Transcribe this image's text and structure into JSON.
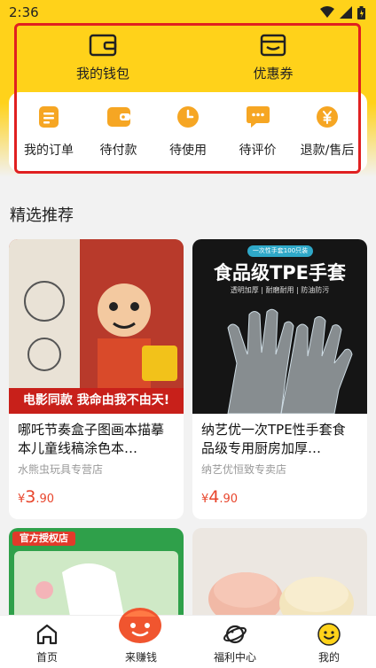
{
  "status_bar": {
    "time": "2:36"
  },
  "wallet": {
    "items": [
      {
        "label": "我的钱包",
        "icon": "wallet-icon"
      },
      {
        "label": "优惠券",
        "icon": "coupon-icon"
      }
    ]
  },
  "orders": {
    "items": [
      {
        "label": "我的订单",
        "icon": "order-list-icon"
      },
      {
        "label": "待付款",
        "icon": "pending-payment-icon"
      },
      {
        "label": "待使用",
        "icon": "clock-icon"
      },
      {
        "label": "待评价",
        "icon": "comment-icon"
      },
      {
        "label": "退款/售后",
        "icon": "refund-icon"
      }
    ]
  },
  "recommend": {
    "title": "精选推荐",
    "products": [
      {
        "title": "哪吒节奏盒子图画本描摹本儿童线稿涂色本…",
        "shop": "水熊虫玩具专营店",
        "price_symbol": "¥",
        "price_int": "3",
        "price_dec": ".90",
        "image_banner": "电影同款 我命由我不由天!"
      },
      {
        "title": "纳艺优一次TPE性手套食品级专用厨房加厚…",
        "shop": "纳艺优恒致专卖店",
        "price_symbol": "¥",
        "price_int": "4",
        "price_dec": ".90",
        "image_heading": "食品级TPE手套",
        "image_tag": "一次性手套100只装",
        "image_features": "透明加厚 | 耐磨耐用 | 防油防污"
      }
    ],
    "partial": [
      {
        "image_badge": "官方授权店"
      }
    ]
  },
  "bottom_nav": {
    "items": [
      {
        "label": "首页",
        "icon": "home-icon"
      },
      {
        "label": "来赚钱",
        "icon": "money-bag-icon"
      },
      {
        "label": "福利中心",
        "icon": "planet-icon"
      },
      {
        "label": "我的",
        "icon": "smile-icon"
      }
    ]
  },
  "colors": {
    "brand_yellow": "#ffd21a",
    "accent_orange": "#f6a623",
    "price_red": "#e8452c",
    "highlight_red": "#e02020"
  }
}
